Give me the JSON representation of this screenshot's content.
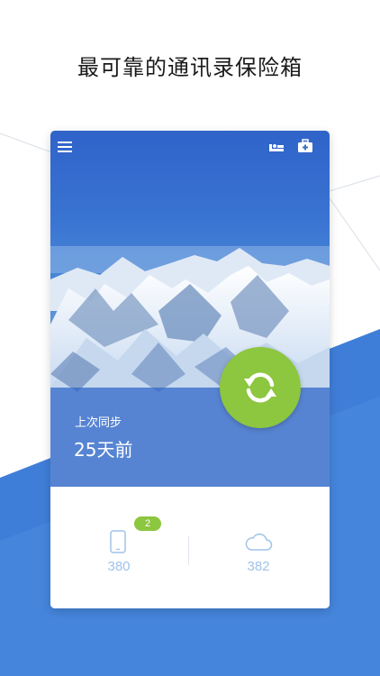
{
  "headline": "最可靠的通讯录保险箱",
  "card": {
    "last_sync_label": "上次同步",
    "last_sync_value": "25天前"
  },
  "stats": {
    "local_count": "380",
    "local_badge": "2",
    "cloud_count": "382"
  },
  "colors": {
    "accent_green": "#8dc63f",
    "brand_blue": "#3b74d6",
    "count_text": "#9fc3ea"
  },
  "icons": [
    "menu-icon",
    "bed-icon",
    "first-aid-kit-icon",
    "sync-icon",
    "phone-icon",
    "cloud-icon"
  ]
}
